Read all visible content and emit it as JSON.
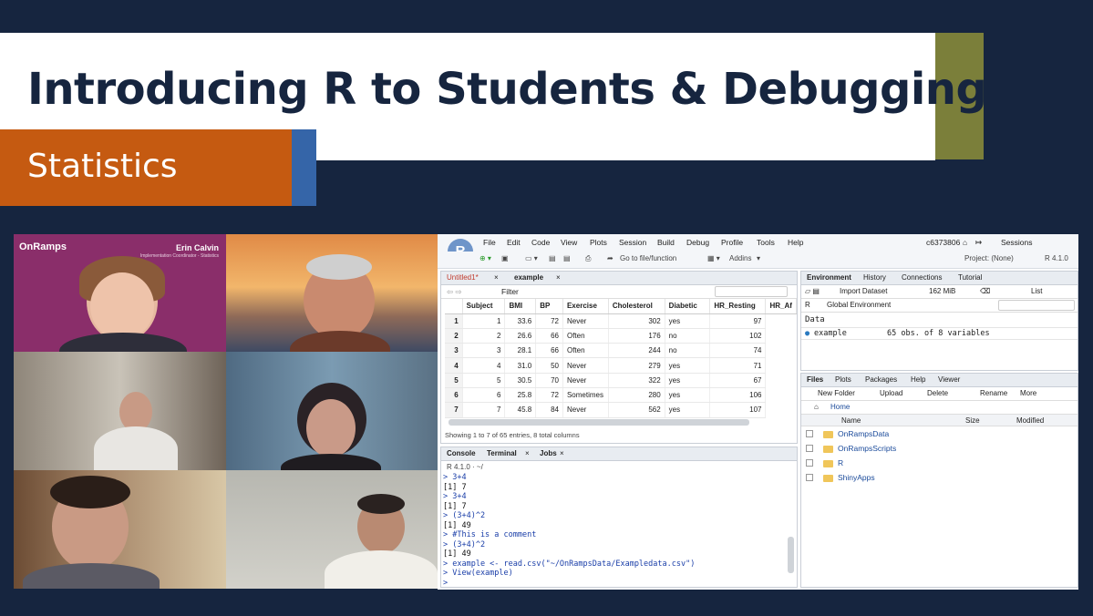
{
  "slide": {
    "title": "Introducing R to Students & Debugging",
    "subtitle": "Statistics",
    "colors": {
      "navy": "#16253f",
      "orange": "#c55a11",
      "olive": "#7b7f3a",
      "blue": "#3565a8"
    }
  },
  "video": {
    "logo": "OnRamps",
    "presenter_name": "Erin Calvin",
    "presenter_role": "Implementation Coordinator - Statistics"
  },
  "rstudio": {
    "logo": "R",
    "menu": [
      "File",
      "Edit",
      "Code",
      "View",
      "Plots",
      "Session",
      "Build",
      "Debug",
      "Profile",
      "Tools",
      "Help"
    ],
    "user": "c6373806",
    "sessions": "Sessions",
    "project": "Project: (None)",
    "version": "R 4.1.0",
    "toolbar": {
      "goto": "Go to file/function",
      "addins": "Addins"
    },
    "editor": {
      "tabs": [
        "Untitled1*",
        "example"
      ],
      "filter": "Filter",
      "columns": [
        "Subject",
        "BMI",
        "BP",
        "Exercise",
        "Cholesterol",
        "Diabetic",
        "HR_Resting",
        "HR_Af"
      ],
      "rows": [
        [
          "1",
          "1",
          "33.6",
          "72",
          "Never",
          "302",
          "yes",
          "97"
        ],
        [
          "2",
          "2",
          "26.6",
          "66",
          "Often",
          "176",
          "no",
          "102"
        ],
        [
          "3",
          "3",
          "28.1",
          "66",
          "Often",
          "244",
          "no",
          "74"
        ],
        [
          "4",
          "4",
          "31.0",
          "50",
          "Never",
          "279",
          "yes",
          "71"
        ],
        [
          "5",
          "5",
          "30.5",
          "70",
          "Never",
          "322",
          "yes",
          "67"
        ],
        [
          "6",
          "6",
          "25.8",
          "72",
          "Sometimes",
          "280",
          "yes",
          "106"
        ],
        [
          "7",
          "7",
          "45.8",
          "84",
          "Never",
          "562",
          "yes",
          "107"
        ]
      ],
      "status": "Showing 1 to 7 of 65 entries, 8 total columns"
    },
    "console": {
      "tabs": [
        "Console",
        "Terminal",
        "Jobs"
      ],
      "path": "R 4.1.0 · ~/",
      "lines": [
        {
          "t": "> 3+4",
          "c": "cmd"
        },
        {
          "t": "[1] 7",
          "c": "out"
        },
        {
          "t": "> 3+4",
          "c": "cmd"
        },
        {
          "t": "[1] 7",
          "c": "out"
        },
        {
          "t": "> (3+4)^2",
          "c": "cmd"
        },
        {
          "t": "[1] 49",
          "c": "out"
        },
        {
          "t": "> #This is a comment",
          "c": "cmd"
        },
        {
          "t": "> (3+4)^2",
          "c": "cmd"
        },
        {
          "t": "[1] 49",
          "c": "out"
        },
        {
          "t": "> example <- read.csv(\"~/OnRampsData/Exampledata.csv\")",
          "c": "cmd"
        },
        {
          "t": ">   View(example)",
          "c": "cmd"
        },
        {
          "t": ">",
          "c": "cmd"
        }
      ]
    },
    "environment": {
      "tabs": [
        "Environment",
        "History",
        "Connections",
        "Tutorial"
      ],
      "import": "Import Dataset",
      "memory": "162 MiB",
      "list": "List",
      "lang": "R",
      "scope": "Global Environment",
      "section": "Data",
      "item_name": "example",
      "item_value": "65 obs. of 8 variables"
    },
    "files": {
      "tabs": [
        "Files",
        "Plots",
        "Packages",
        "Help",
        "Viewer"
      ],
      "tools": [
        "New Folder",
        "Upload",
        "Delete",
        "Rename",
        "More"
      ],
      "home": "Home",
      "headers": [
        "Name",
        "Size",
        "Modified"
      ],
      "items": [
        "OnRampsData",
        "OnRampsScripts",
        "R",
        "ShinyApps"
      ]
    }
  }
}
